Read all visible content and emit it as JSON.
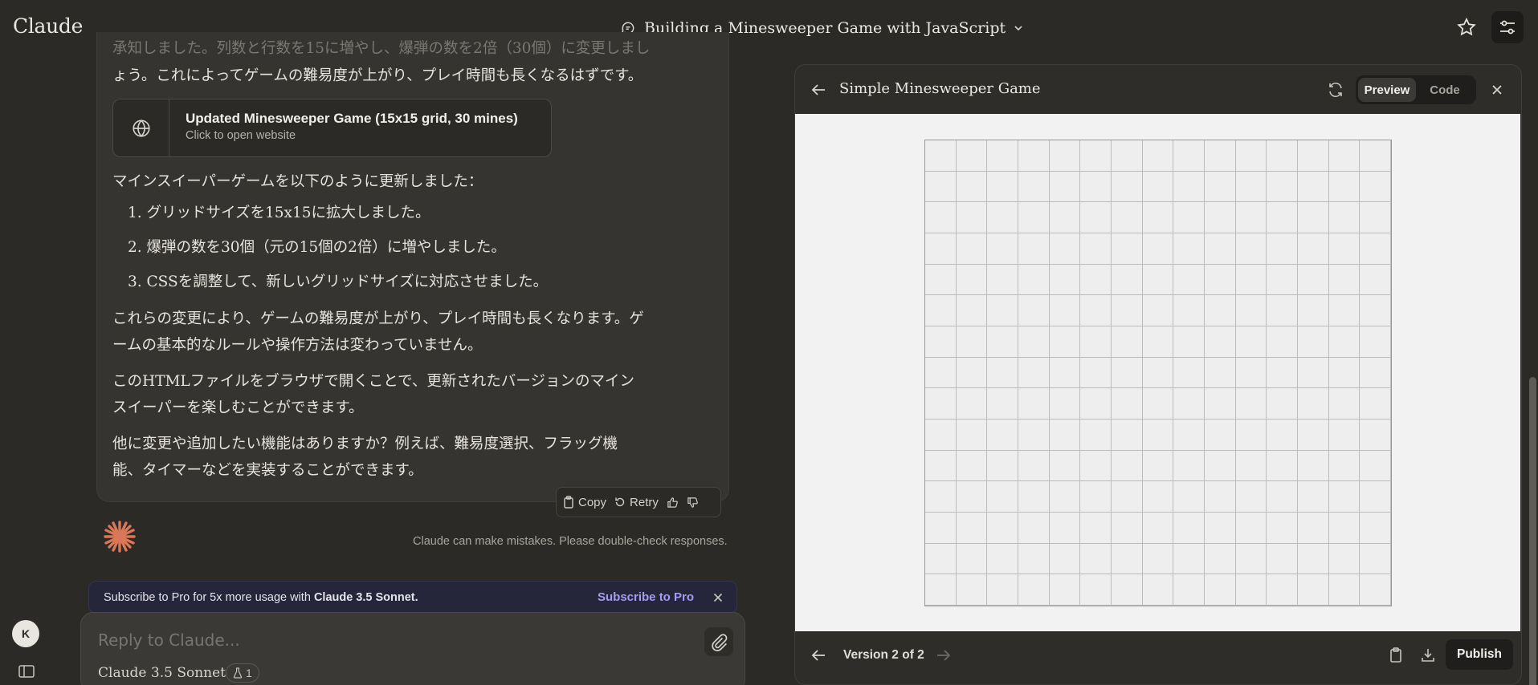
{
  "app": {
    "logo": "Claude"
  },
  "header": {
    "conversation_title": "Building a Minesweeper Game with JavaScript"
  },
  "message": {
    "intro_faded": "承知しました。列数と行数を15に増やし、爆弾の数を2倍（30個）に変更しまし",
    "intro_line": "ょう。これによってゲームの難易度が上がり、プレイ時間も長くなるはずです。",
    "artifact": {
      "title": "Updated Minesweeper Game (15x15 grid, 30 mines)",
      "subtitle": "Click to open website",
      "icon": "globe-icon"
    },
    "update_intro": "マインスイーパーゲームを以下のように更新しました：",
    "list": [
      "1. グリッドサイズを15x15に拡大しました。",
      "2. 爆弾の数を30個（元の15個の2倍）に増やしました。",
      "3. CSSを調整して、新しいグリッドサイズに対応させました。"
    ],
    "para1_l1": "これらの変更により、ゲームの難易度が上がり、プレイ時間も長くなります。ゲ",
    "para1_l2": "ームの基本的なルールや操作方法は変わっていません。",
    "para2_l1": "このHTMLファイルをブラウザで開くことで、更新されたバージョンのマイン",
    "para2_l2": "スイーパーを楽しむことができます。",
    "para3_l1": "他に変更や追加したい機能はありますか？例えば、難易度選択、フラッグ機",
    "para3_l2": "能、タイマーなどを実装することができます。"
  },
  "actions": {
    "copy": "Copy",
    "retry": "Retry"
  },
  "disclaimer": "Claude can make mistakes. Please double-check responses.",
  "promo": {
    "text_prefix": "Subscribe to Pro for 5x more usage with ",
    "text_bold": "Claude 3.5 Sonnet.",
    "link": "Subscribe to Pro"
  },
  "composer": {
    "placeholder": "Reply to Claude...",
    "model": "Claude 3.5 Sonnet",
    "badge_count": "1"
  },
  "user": {
    "avatar_initial": "K"
  },
  "panel": {
    "title": "Simple Minesweeper Game",
    "tabs": [
      "Preview",
      "Code"
    ],
    "active_tab": "Preview",
    "version": "Version 2 of 2",
    "publish": "Publish",
    "grid": {
      "rows": 15,
      "cols": 15
    }
  },
  "colors": {
    "accent_orange": "#d97757",
    "promo_link": "#a59bf0",
    "background": "#2b2a27"
  }
}
